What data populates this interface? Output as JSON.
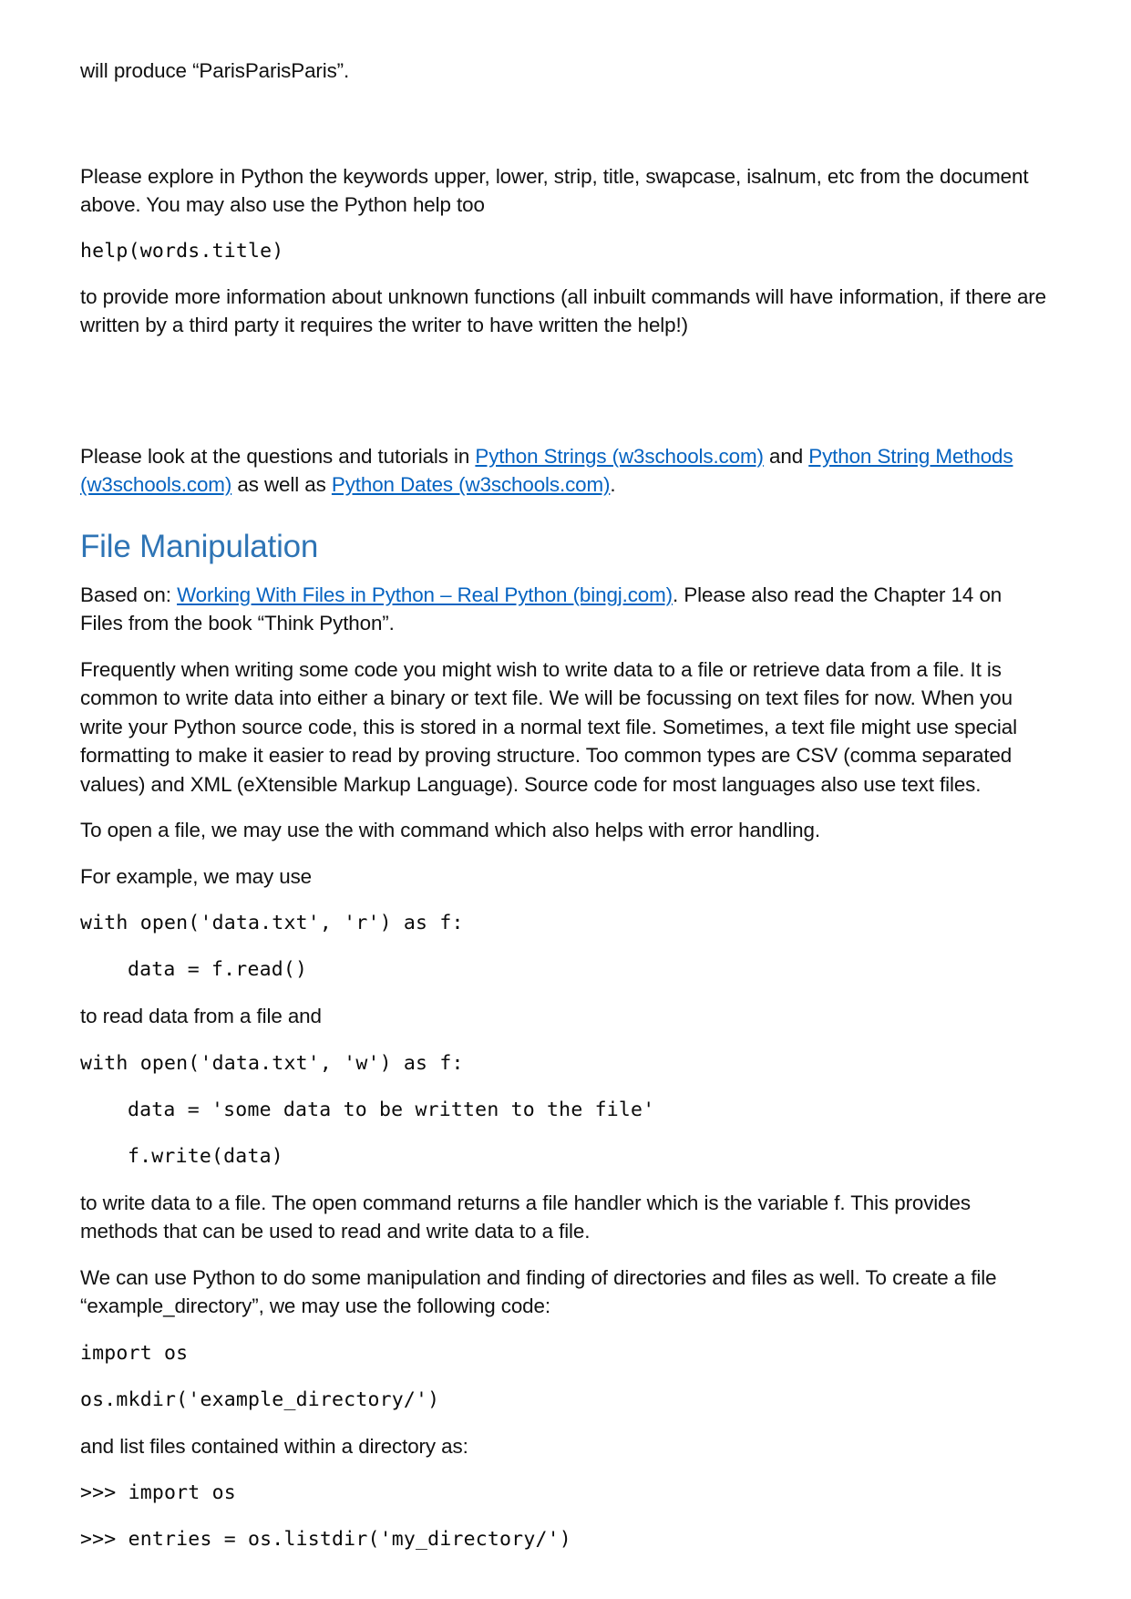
{
  "document": {
    "paragraphs": {
      "produce_line": "will produce “ParisParisParis”.",
      "explore_keywords": "Please explore in Python the keywords upper, lower, strip, title, swapcase, isalnum, etc from the document above. You may also use the Python help too",
      "help_code": "help(words.title)",
      "more_information": "to provide more information about unknown functions (all inbuilt commands will have information, if there are written by a third party it requires the writer to have written the help!)",
      "look_at_questions_prefix": "Please look at the questions and tutorials in ",
      "link_python_strings": "Python Strings (w3schools.com)",
      "look_and": " and ",
      "link_python_string_methods": "Python String Methods (w3schools.com)",
      "look_as_well_as": " as well as ",
      "link_python_dates": "Python Dates (w3schools.com)",
      "look_end": ".",
      "heading_file_manipulation": "File Manipulation",
      "based_on_prefix": "Based on: ",
      "link_working_with_files": "Working With Files in Python – Real Python (bingj.com)",
      "based_on_suffix": ". Please also read the Chapter 14 on Files from the book “Think Python”.",
      "frequently_writing": "Frequently when writing some code you might wish to write data to a file or retrieve data from a file. It is common to write data into either a binary or text file. We will be focussing on text files for now. When you write your Python source code, this is stored in a normal text file. Sometimes, a text file might use special formatting to make it easier to read by proving structure. Too common types are CSV (comma separated values) and XML (eXtensible Markup Language). Source code for most languages also use text files.",
      "to_open_a_file": "To open a file, we may use the with command which also helps with error handling.",
      "for_example": "For example, we may use",
      "to_read_data": "to read data from a file and",
      "to_write_data": "to write data to a file. The open command returns a file handler which is the variable f. This provides methods that can be used to read and write data to a file.",
      "we_can_use_python": "We can use Python to do some manipulation and finding of directories and files as well. To create a file “example_directory”, we may use the following code:",
      "and_list_files": "and list files contained within a directory as:"
    },
    "code_blocks": {
      "read_open": "with open('data.txt', 'r') as f:",
      "read_body": "data = f.read()",
      "write_open": "with open('data.txt', 'w') as f:",
      "write_body_1": "data = 'some data to be written to the file'",
      "write_body_2": "f.write(data)",
      "import_os": "import os",
      "mkdir": "os.mkdir('example_directory/')",
      "repl_import_os": ">>> import os",
      "repl_listdir": ">>> entries = os.listdir('my_directory/')"
    },
    "colors": {
      "heading": "#2E74B5",
      "link": "#0563C1",
      "text": "#111111",
      "background": "#FFFFFF"
    }
  }
}
